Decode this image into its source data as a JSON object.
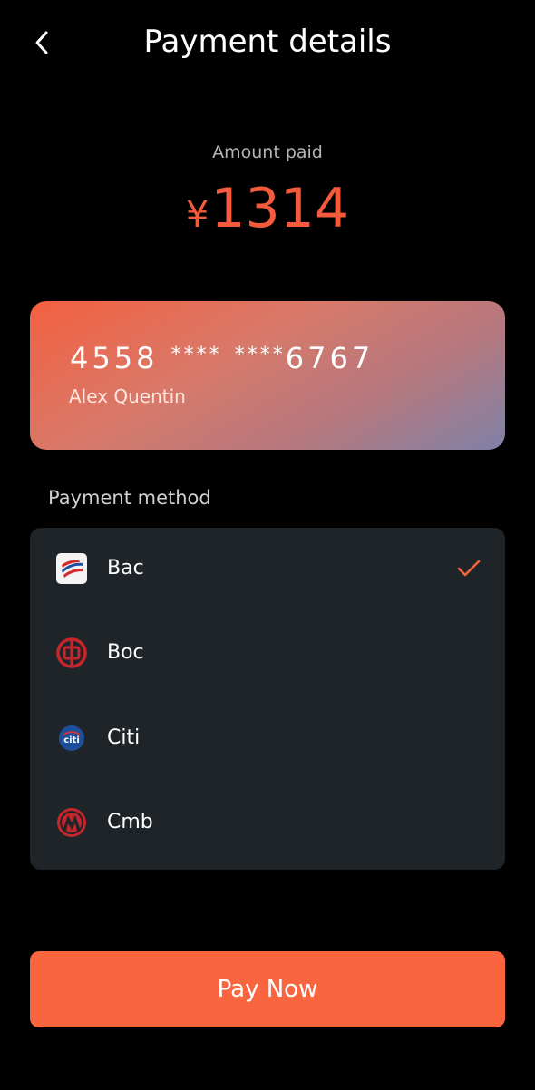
{
  "header": {
    "title": "Payment details",
    "back_icon": "chevron-left-icon"
  },
  "amount": {
    "label": "Amount paid",
    "currency_symbol": "¥",
    "value": "1314",
    "color": "#f45b3c"
  },
  "card": {
    "number_prefix": "4558",
    "mask_1": "****",
    "mask_2": "****",
    "number_suffix": "6767",
    "holder": "Alex Quentin",
    "gradient_start": "#f3603f",
    "gradient_end": "#7f82a8"
  },
  "payment_method": {
    "label": "Payment method",
    "selected": "Bac",
    "items": [
      {
        "name": "Bac",
        "icon": "bank-of-america-logo-icon",
        "selected": true
      },
      {
        "name": "Boc",
        "icon": "bank-of-china-logo-icon",
        "selected": false
      },
      {
        "name": "Citi",
        "icon": "citi-logo-icon",
        "selected": false
      },
      {
        "name": "Cmb",
        "icon": "china-merchants-bank-logo-icon",
        "selected": false
      }
    ]
  },
  "actions": {
    "pay_label": "Pay Now",
    "accent": "#f8653f"
  }
}
